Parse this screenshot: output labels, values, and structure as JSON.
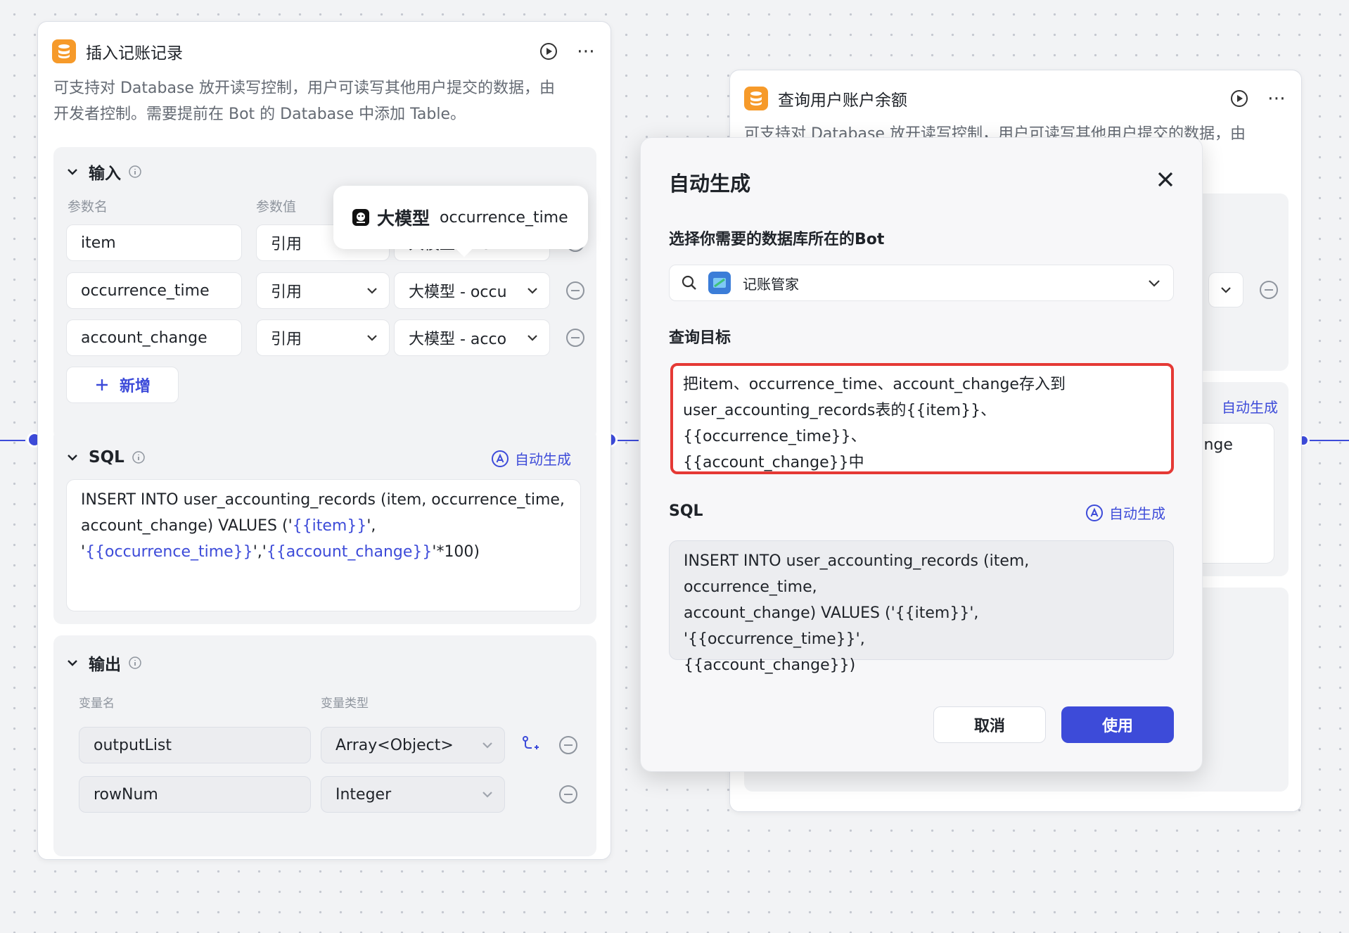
{
  "left_node": {
    "title": "插入记账记录",
    "icon": "database-icon",
    "desc_line1": "可支持对 Database 放开读写控制，用户可读写其他用户提交的数据，由",
    "desc_line2": "开发者控制。需要提前在 Bot 的 Database 中添加 Table。",
    "input": {
      "heading": "输入",
      "col_param_name": "参数名",
      "col_param_value": "参数值",
      "rows": [
        {
          "name": "item",
          "type": "引用",
          "value": "大模型 - item"
        },
        {
          "name": "occurrence_time",
          "type": "引用",
          "value": "大模型 - occu"
        },
        {
          "name": "account_change",
          "type": "引用",
          "value": "大模型 - acco"
        }
      ],
      "add_label": "新增"
    },
    "sql": {
      "heading": "SQL",
      "auto_label": "自动生成",
      "line1": "INSERT INTO user_accounting_records (item, occurrence_time,",
      "line2_a": "account_change) VALUES ('",
      "line2_var": "{{item}}",
      "line2_b": "',",
      "line3_a": "'",
      "line3_var1": "{{occurrence_time}}",
      "line3_b": "','",
      "line3_var2": "{{account_change}}",
      "line3_c": "'*100)"
    },
    "output": {
      "heading": "输出",
      "col_var_name": "变量名",
      "col_var_type": "变量类型",
      "rows": [
        {
          "name": "outputList",
          "type": "Array<Object>"
        },
        {
          "name": "rowNum",
          "type": "Integer"
        }
      ]
    }
  },
  "tooltip": {
    "model_label": "大模型",
    "var_label": "occurrence_time"
  },
  "right_node": {
    "title": "查询用户账户余额",
    "desc_line1": "可支持对 Database 放开读写控制，用户可读写其他用户提交的数据，由",
    "auto_label": "自动生成",
    "frag_text": "ange"
  },
  "modal": {
    "title": "自动生成",
    "bot_label": "选择你需要的数据库所在的Bot",
    "bot_selected": "记账管家",
    "goal_label": "查询目标",
    "goal_line1": "把item、occurrence_time、account_change存入到",
    "goal_line2": "user_accounting_records表的{{item}}、{{occurrence_time}}、",
    "goal_line3": "{{account_change}}中",
    "sql_label": "SQL",
    "sql_auto_label": "自动生成",
    "sql_line1": "INSERT INTO user_accounting_records (item, occurrence_time,",
    "sql_line2": "account_change) VALUES ('{{item}}', '{{occurrence_time}}',",
    "sql_line3": "{{account_change}})",
    "cancel_label": "取消",
    "use_label": "使用"
  },
  "colors": {
    "accent": "#3d4bd9",
    "db_icon": "#f69a2a",
    "highlight_border": "#e53935"
  }
}
